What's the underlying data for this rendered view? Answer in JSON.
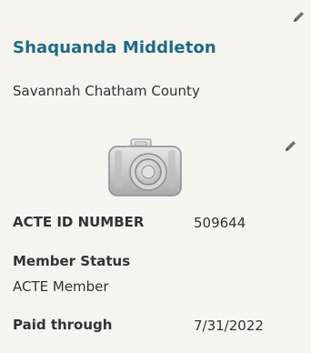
{
  "member": {
    "name": "Shaquanda Middleton",
    "organization": "Savannah Chatham County"
  },
  "icons": {
    "edit_profile": "pencil-icon",
    "edit_photo": "pencil-icon",
    "photo_placeholder": "camera-icon"
  },
  "fields": {
    "acte_id_label": "ACTE ID NUMBER",
    "acte_id_value": "509644",
    "member_status_label": "Member Status",
    "member_status_value": "ACTE Member",
    "paid_through_label": "Paid through",
    "paid_through_value": "7/31/2022"
  },
  "colors": {
    "card_background": "#f6f4ef",
    "name_color": "#1f6a86",
    "text_color": "#333333"
  }
}
